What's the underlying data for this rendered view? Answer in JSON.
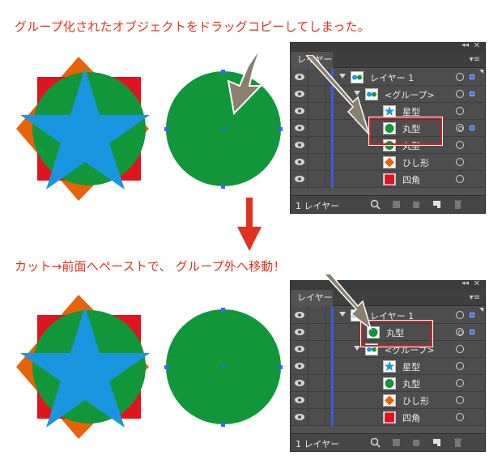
{
  "captions": {
    "top": "グループ化されたオブジェクトをドラッグコピーしてしまった。",
    "bottom": "カット→前面へペーストで、 グループ外へ移動！"
  },
  "panel": {
    "tab_label": "レイヤー",
    "collapse_glyph": "◂◂",
    "close_glyph": "✕",
    "menu_glyph": "▾≡",
    "footer_count": "1 レイヤー"
  },
  "top_rows": [
    {
      "label": "レイヤー 1",
      "icon": "layer-thumb"
    },
    {
      "label": "<グループ>",
      "icon": "group-thumb"
    },
    {
      "label": "星型",
      "icon": "star-thumb"
    },
    {
      "label": "丸型",
      "icon": "circle-thumb"
    },
    {
      "label": "丸型",
      "icon": "circle-thumb"
    },
    {
      "label": "ひし形",
      "icon": "diamond-thumb"
    },
    {
      "label": "四角",
      "icon": "square-thumb"
    }
  ],
  "bottom_rows": [
    {
      "label": "レイヤー 1",
      "icon": "layer-thumb"
    },
    {
      "label": "丸型",
      "icon": "circle-thumb"
    },
    {
      "label": "<グループ>",
      "icon": "group-thumb"
    },
    {
      "label": "星型",
      "icon": "star-thumb"
    },
    {
      "label": "丸型",
      "icon": "circle-thumb"
    },
    {
      "label": "ひし形",
      "icon": "diamond-thumb"
    },
    {
      "label": "四角",
      "icon": "square-thumb"
    }
  ],
  "colors": {
    "caption": "#e0321e",
    "star": "#1a96e0",
    "circle": "#12963a",
    "diamond": "#e8620a",
    "square": "#e0141e",
    "selection": "#2f6bff",
    "highlight": "#d81e1e",
    "arrow": "#8a8070"
  }
}
